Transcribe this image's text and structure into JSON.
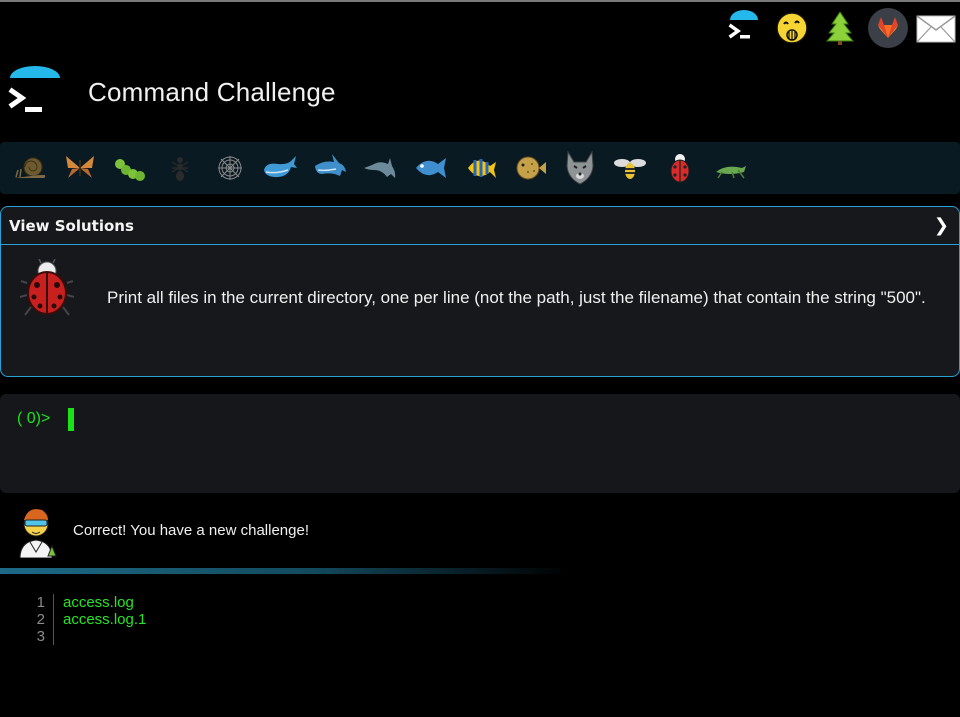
{
  "app": {
    "title": "Command Challenge"
  },
  "top_icons": [
    {
      "name": "terminal-link-icon"
    },
    {
      "name": "shush-emoji-icon"
    },
    {
      "name": "tree-icon"
    },
    {
      "name": "gitlab-icon"
    },
    {
      "name": "mail-icon"
    }
  ],
  "levels": [
    {
      "name": "snail-icon"
    },
    {
      "name": "butterfly-icon"
    },
    {
      "name": "caterpillar-icon"
    },
    {
      "name": "ant-icon"
    },
    {
      "name": "spider-web-icon"
    },
    {
      "name": "whale-icon"
    },
    {
      "name": "shark-icon"
    },
    {
      "name": "dolphin-icon"
    },
    {
      "name": "fish-icon"
    },
    {
      "name": "tropical-fish-icon"
    },
    {
      "name": "blowfish-icon"
    },
    {
      "name": "wolf-icon"
    },
    {
      "name": "bee-icon"
    },
    {
      "name": "ladybug-icon"
    },
    {
      "name": "cricket-icon"
    }
  ],
  "challenge": {
    "view_solutions": "View Solutions",
    "chevron": "❯",
    "description": "Print all files in the current directory, one per line (not the path, just the filename) that contain the string \"500\"."
  },
  "terminal": {
    "prompt": "( 0)>"
  },
  "feedback": {
    "message": "Correct! You have a new challenge!"
  },
  "output": {
    "lines": [
      {
        "num": "1",
        "text": "access.log"
      },
      {
        "num": "2",
        "text": "access.log.1"
      },
      {
        "num": "3",
        "text": ""
      }
    ]
  },
  "colors": {
    "accent": "#2aa1d6",
    "prompt_green": "#20e020",
    "panel_bg": "#17181c",
    "levels_bg": "#0a1a22"
  }
}
